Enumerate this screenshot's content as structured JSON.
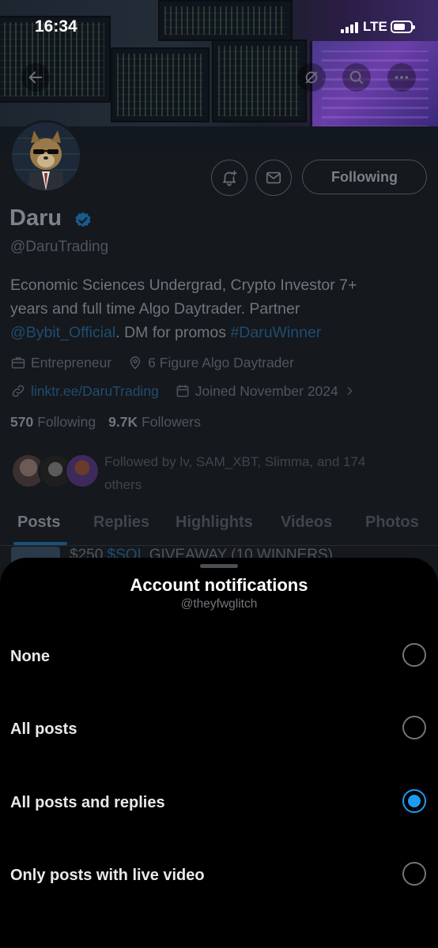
{
  "status_bar": {
    "time": "16:34",
    "network": "LTE"
  },
  "profile": {
    "name": "Daru",
    "handle": "@DaruTrading",
    "following_button": "Following",
    "bio": {
      "line1": "Economic Sciences Undergrad, Crypto Investor 7+",
      "line2": "years and full time Algo Daytrader. Partner",
      "mention": "@Bybit_Official",
      "text_after_mention": ". DM for promos ",
      "hashtag": "#DaruWinner"
    },
    "category": "Entrepreneur",
    "location": "6 Figure Algo Daytrader",
    "website": "linktr.ee/DaruTrading",
    "joined": "Joined November 2024",
    "following_count": "570",
    "following_label": "Following",
    "followers_count": "9.7K",
    "followers_label": "Followers",
    "followed_by_line1": "Followed by lv, SAM_XBT, Slimma, and 174",
    "followed_by_line2": "others",
    "tabs": [
      "Posts",
      "Replies",
      "Highlights",
      "Videos",
      "Photos"
    ],
    "peek_post": {
      "prefix": "$250 ",
      "cashtag": "$SOL",
      "suffix": " GIVEAWAY (10 WINNERS)"
    }
  },
  "sheet": {
    "title": "Account notifications",
    "subtitle": "@theyfwglitch",
    "options": [
      {
        "label": "None",
        "selected": false
      },
      {
        "label": "All posts",
        "selected": false
      },
      {
        "label": "All posts and replies",
        "selected": true
      },
      {
        "label": "Only posts with live video",
        "selected": false
      }
    ]
  },
  "colors": {
    "accent": "#1d9bf0",
    "sheet_bg": "#000000",
    "dimmed_bg": "#15181c"
  }
}
